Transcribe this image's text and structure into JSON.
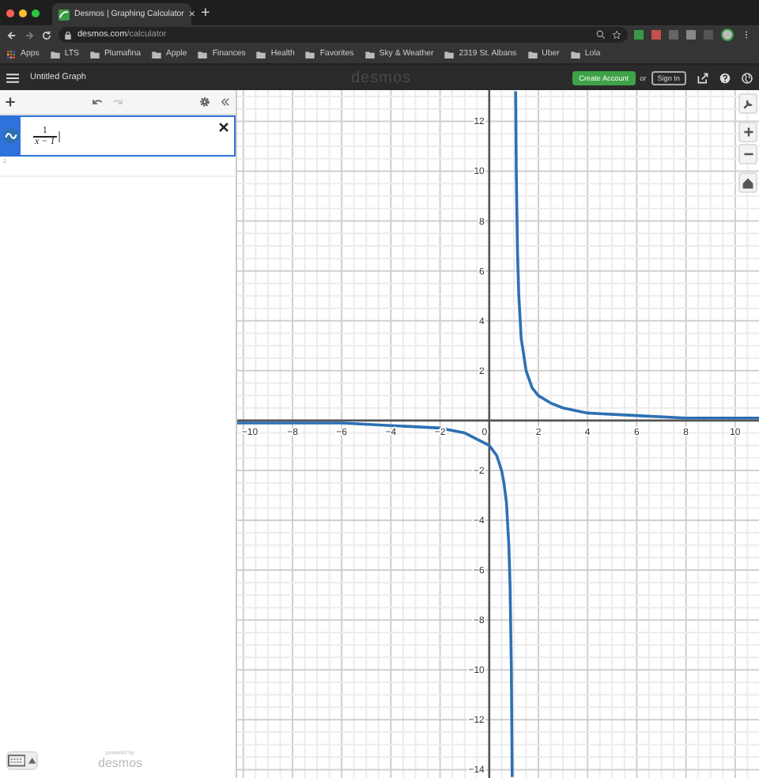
{
  "browser": {
    "tab_title": "Desmos | Graphing Calculator",
    "tab_close": "×",
    "new_tab": "+",
    "url_host": "desmos.com",
    "url_path": "/calculator",
    "bookmarks": [
      {
        "label": "Apps",
        "kind": "apps"
      },
      {
        "label": "LTS",
        "kind": "folder"
      },
      {
        "label": "Plumafina",
        "kind": "folder"
      },
      {
        "label": "Apple",
        "kind": "folder"
      },
      {
        "label": "Finances",
        "kind": "folder"
      },
      {
        "label": "Health",
        "kind": "folder"
      },
      {
        "label": "Favorites",
        "kind": "folder"
      },
      {
        "label": "Sky & Weather",
        "kind": "folder"
      },
      {
        "label": "2319 St. Albans",
        "kind": "folder"
      },
      {
        "label": "Uber",
        "kind": "folder"
      },
      {
        "label": "Lola",
        "kind": "folder"
      }
    ]
  },
  "header": {
    "title": "Untitled Graph",
    "logo": "desmos",
    "create_account": "Create Account",
    "or": "or",
    "sign_in": "Sign In"
  },
  "expressions": [
    {
      "numerator": "1",
      "denominator": "x − 1",
      "selected": true
    }
  ],
  "next_row_number": "2",
  "footer": {
    "powered_by": "powered by",
    "logo": "desmos"
  },
  "graph": {
    "chart_data": {
      "type": "line",
      "grid": true,
      "xlim": [
        -10.25,
        10.97
      ],
      "ylim": [
        -14.4,
        13.25
      ],
      "xticks": [
        -10,
        -8,
        -6,
        -4,
        -2,
        0,
        2,
        4,
        6,
        8,
        10
      ],
      "yticks": [
        -14,
        -12,
        -10,
        -8,
        -6,
        -4,
        -2,
        2,
        4,
        6,
        8,
        10,
        12
      ],
      "x": [
        -10.25,
        -8,
        -6,
        -4,
        -2,
        -1,
        0,
        0.3,
        0.5,
        0.6,
        0.7,
        0.8,
        0.85,
        0.9,
        0.93,
        1.076,
        1.08,
        1.1,
        1.15,
        1.2,
        1.3,
        1.5,
        1.75,
        2,
        2.5,
        3,
        4,
        6,
        8,
        10,
        10.97
      ],
      "series": [
        {
          "color": "#2d70b3",
          "values": [
            -0.1,
            -0.1,
            -0.1,
            -0.2,
            -0.3,
            -0.5,
            -1,
            -1.4,
            -2,
            -2.5,
            -3.3,
            -5,
            -6.7,
            -10,
            -14.3,
            13.2,
            12.5,
            10,
            6.7,
            5,
            3.3,
            2,
            1.3,
            1,
            0.7,
            0.5,
            0.3,
            0.2,
            0.1,
            0.1,
            0.1
          ]
        }
      ]
    }
  }
}
